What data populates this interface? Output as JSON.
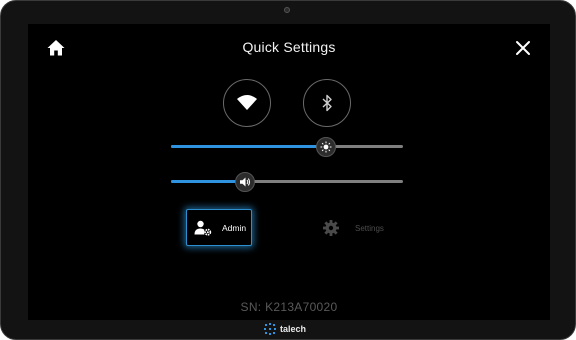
{
  "header": {
    "title": "Quick Settings",
    "home_icon": "home-icon",
    "close_icon": "close-icon"
  },
  "toggles": [
    {
      "name": "wifi",
      "icon": "wifi-icon"
    },
    {
      "name": "bluetooth",
      "icon": "bluetooth-icon"
    }
  ],
  "sliders": {
    "brightness": {
      "icon": "brightness-icon",
      "value_percent": 67
    },
    "volume": {
      "icon": "volume-icon",
      "value_percent": 32
    }
  },
  "buttons": {
    "admin_label": "Admin",
    "admin_icon": "admin-user-gear-icon",
    "settings_label": "Settings",
    "settings_icon": "gear-icon"
  },
  "serial_number": "SN: K213A70020",
  "brand": {
    "name": "talech",
    "icon": "talech-logo"
  },
  "colors": {
    "accent": "#2f93e0",
    "track": "#7f7f7f",
    "background": "#000000",
    "bezel": "#131313"
  }
}
